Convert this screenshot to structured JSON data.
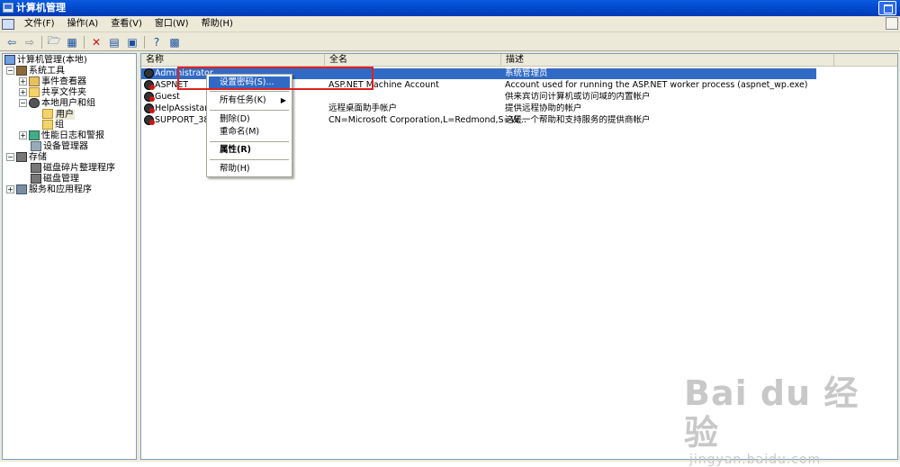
{
  "window": {
    "title": "计算机管理"
  },
  "menu": {
    "items": [
      "文件(F)",
      "操作(A)",
      "查看(V)",
      "窗口(W)",
      "帮助(H)"
    ]
  },
  "toolbar": {
    "icons": [
      "back-icon",
      "forward-icon",
      "up-folder-icon",
      "show-tree-icon",
      "delete-icon",
      "properties-icon",
      "help-icon",
      "console-icon"
    ]
  },
  "tree": {
    "root": "计算机管理(本地)",
    "system_tools": "系统工具",
    "event_viewer": "事件查看器",
    "shared_folders": "共享文件夹",
    "local_users_groups": "本地用户和组",
    "users": "用户",
    "groups": "组",
    "perf_logs": "性能日志和警报",
    "device_manager": "设备管理器",
    "storage": "存储",
    "defrag": "磁盘碎片整理程序",
    "disk_mgmt": "磁盘管理",
    "services_apps": "服务和应用程序"
  },
  "list": {
    "columns": [
      "名称",
      "全名",
      "描述"
    ],
    "rows": [
      {
        "name": "Administrator",
        "full": "",
        "desc": "系统管理员"
      },
      {
        "name": "ASPNET",
        "full": "ASP.NET Machine Account",
        "desc": "Account used for running the ASP.NET worker process (aspnet_wp.exe)"
      },
      {
        "name": "Guest",
        "full": "",
        "desc": "供来宾访问计算机或访问域的内置帐户"
      },
      {
        "name": "HelpAssistant",
        "full": "远程桌面助手帐户",
        "desc": "提供远程协助的帐户"
      },
      {
        "name": "SUPPORT_3889",
        "full": "CN=Microsoft Corporation,L=Redmond,S=W...",
        "desc": "这是一个帮助和支持服务的提供商帐户"
      }
    ]
  },
  "context_menu": {
    "set_password": "设置密码(S)...",
    "all_tasks": "所有任务(K)",
    "delete": "删除(D)",
    "rename": "重命名(M)",
    "properties": "属性(R)",
    "help": "帮助(H)"
  },
  "watermark": {
    "brand": "Bai du 经验",
    "url": "jingyan.baidu.com"
  }
}
